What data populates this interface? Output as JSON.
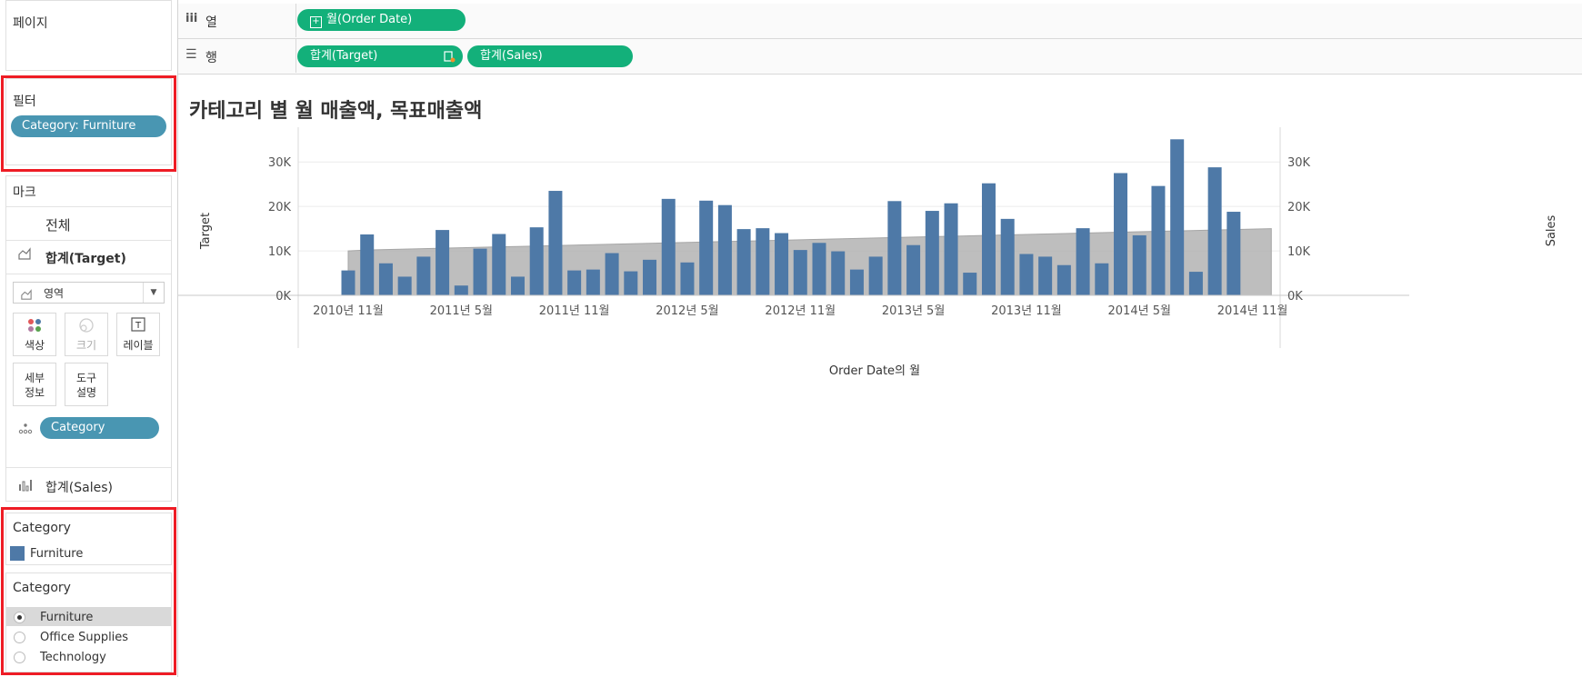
{
  "sidebar": {
    "pages_title": "페이지",
    "filters_title": "필터",
    "filter_pill": "Category: Furniture",
    "marks_title": "마크",
    "marks_all": "전체",
    "marks_target": "합계(Target)",
    "mark_type": "영역",
    "mark_buttons": {
      "color": "색상",
      "size": "크기",
      "label": "레이블",
      "detail_1": "세부",
      "detail_2": "정보",
      "tooltip_1": "도구",
      "tooltip_2": "설명"
    },
    "category_pill": "Category",
    "marks_sales": "합계(Sales)",
    "legend": {
      "title": "Category",
      "item": "Furniture",
      "color": "#4e79a7"
    },
    "param": {
      "title": "Category",
      "options": [
        "Furniture",
        "Office Supplies",
        "Technology"
      ],
      "selected": "Furniture"
    }
  },
  "shelves": {
    "columns": {
      "label": "열",
      "pill": "월(Order Date)"
    },
    "rows": {
      "label": "행",
      "pills": [
        "합계(Target)",
        "합계(Sales)"
      ]
    }
  },
  "chart_data": {
    "type": "bar",
    "title": "카테고리 별 월 매출액, 목표매출액",
    "xlabel": "Order Date의 월",
    "ylabel": "Target",
    "y2label": "Sales",
    "ylim": [
      -1500,
      37000
    ],
    "yticks": [
      "0K",
      "10K",
      "20K",
      "30K"
    ],
    "ytick_values": [
      0,
      10000,
      20000,
      30000
    ],
    "xtick_labels": [
      "2010년 11월",
      "2011년 5월",
      "2011년 11월",
      "2012년 5월",
      "2012년 11월",
      "2013년 5월",
      "2013년 11월",
      "2014년 5월",
      "2014년 11월"
    ],
    "xtick_index": [
      0,
      6,
      12,
      18,
      24,
      30,
      36,
      42,
      48
    ],
    "categories": [
      "2010-11",
      "2010-12",
      "2011-01",
      "2011-02",
      "2011-03",
      "2011-04",
      "2011-05",
      "2011-06",
      "2011-07",
      "2011-08",
      "2011-09",
      "2011-10",
      "2011-11",
      "2011-12",
      "2012-01",
      "2012-02",
      "2012-03",
      "2012-04",
      "2012-05",
      "2012-06",
      "2012-07",
      "2012-08",
      "2012-09",
      "2012-10",
      "2012-11",
      "2012-12",
      "2013-01",
      "2013-02",
      "2013-03",
      "2013-04",
      "2013-05",
      "2013-06",
      "2013-07",
      "2013-08",
      "2013-09",
      "2013-10",
      "2013-11",
      "2013-12",
      "2014-01",
      "2014-02",
      "2014-03",
      "2014-04",
      "2014-05",
      "2014-06",
      "2014-07",
      "2014-08",
      "2014-09",
      "2014-10",
      "2014-11",
      "2014-12"
    ],
    "series": [
      {
        "name": "합계(Sales)",
        "kind": "bar",
        "color": "#4e79a7",
        "values": [
          5600,
          13700,
          7200,
          4200,
          8700,
          14700,
          2200,
          10500,
          13800,
          4200,
          15300,
          23500,
          5600,
          5800,
          9500,
          5400,
          8000,
          21700,
          7400,
          21300,
          20300,
          14900,
          15100,
          14000,
          10200,
          11800,
          9900,
          5800,
          8700,
          21200,
          11300,
          19000,
          20700,
          5100,
          25200,
          17200,
          9300,
          8700,
          6800,
          15100,
          7200,
          27500,
          13500,
          24600,
          35100,
          5300,
          28800,
          18800
        ]
      },
      {
        "name": "합계(Target)",
        "kind": "area",
        "color": "#b3b3b3",
        "values": [
          10000,
          10200,
          10300,
          10400,
          10500,
          10600,
          10700,
          10800,
          10900,
          11000,
          11100,
          11200,
          11300,
          11400,
          11500,
          11600,
          11700,
          11800,
          11900,
          12000,
          12100,
          12200,
          12300,
          12400,
          12500,
          12600,
          12700,
          12800,
          12900,
          13000,
          13100,
          13200,
          13300,
          13400,
          13500,
          13600,
          13700,
          13800,
          13900,
          14000,
          14100,
          14200,
          14300,
          14400,
          14500,
          14600,
          14700,
          14800,
          14900,
          15000
        ]
      }
    ]
  }
}
